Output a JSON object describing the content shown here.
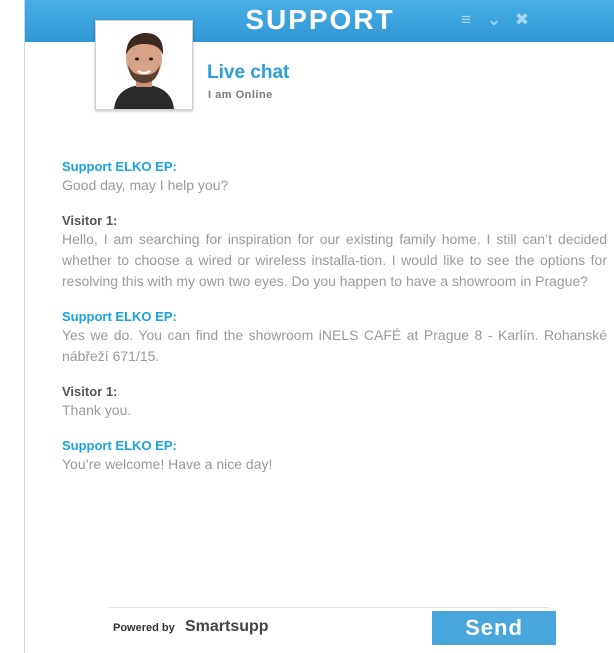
{
  "header": {
    "title": "SUPPORT",
    "controls": [
      {
        "icon": "menu-icon",
        "glyph": "≡"
      },
      {
        "icon": "minimize-chevron-icon",
        "glyph": "⌄"
      },
      {
        "icon": "close-icon",
        "glyph": "✖"
      }
    ]
  },
  "agent": {
    "chat_title": "Live chat",
    "status": "I am Online"
  },
  "messages": [
    {
      "sender": "Support ELKO EP:",
      "type": "support",
      "text": "Good day, may I help you?"
    },
    {
      "sender": "Visitor 1:",
      "type": "visitor",
      "text": "Hello, I am searching for inspiration for our existing family home. I still can’t decided whether to choose a wired or wireless installa-tion. I would like to see the options for resolving this with my own two eyes. Do you happen to have a showroom in Prague?"
    },
    {
      "sender": "Support ELKO EP:",
      "type": "support",
      "text": "Yes we do. You can find the showroom iNELS CAFÉ at Prague 8 - Karlín. Rohanské nábřeží 671/15."
    },
    {
      "sender": "Visitor 1:",
      "type": "visitor",
      "text": "Thank you."
    },
    {
      "sender": "Support ELKO EP:",
      "type": "support",
      "text": "You’re welcome! Have a nice day!"
    }
  ],
  "footer": {
    "powered_by": "Powered by",
    "brand": "Smartsupp",
    "send_label": "Send"
  },
  "colors": {
    "header": "#3ea5df",
    "support_name": "#17a4e0",
    "send_button": "#48a6dc"
  }
}
